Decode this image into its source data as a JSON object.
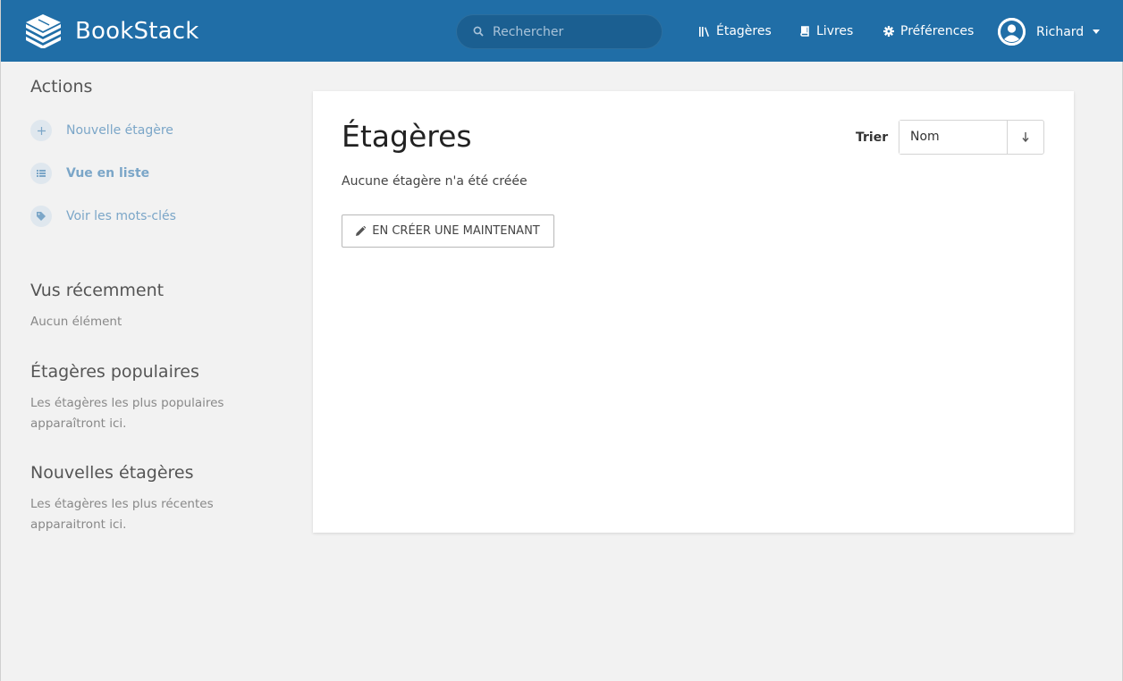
{
  "app": {
    "name": "BookStack"
  },
  "header": {
    "search_placeholder": "Rechercher",
    "nav": {
      "shelves": "Étagères",
      "books": "Livres",
      "settings": "Préférences"
    },
    "user_name": "Richard"
  },
  "sidebar": {
    "actions_title": "Actions",
    "actions": [
      {
        "label": "Nouvelle étagère",
        "icon": "plus-icon"
      },
      {
        "label": "Vue en liste",
        "icon": "list-icon"
      },
      {
        "label": "Voir les mots-clés",
        "icon": "tag-icon"
      }
    ],
    "recent": {
      "title": "Vus récemment",
      "text": "Aucun élément"
    },
    "popular": {
      "title": "Étagères populaires",
      "text_line1": "Les étagères les plus populaires",
      "text_line2": "apparaîtront ici."
    },
    "new": {
      "title": "Nouvelles étagères",
      "text_line1": "Les étagères les plus récentes",
      "text_line2": "apparaitront ici."
    }
  },
  "main": {
    "title": "Étagères",
    "sort_label": "Trier",
    "sort_value": "Nom",
    "sort_direction_icon": "arrow-down-icon",
    "empty_text": "Aucune étagère n'a été créée",
    "create_button": "EN CRÉER UNE MAINTENANT"
  },
  "colors": {
    "header": "#206ea7",
    "link": "#7ba6c8",
    "background": "#f2f2f2"
  }
}
